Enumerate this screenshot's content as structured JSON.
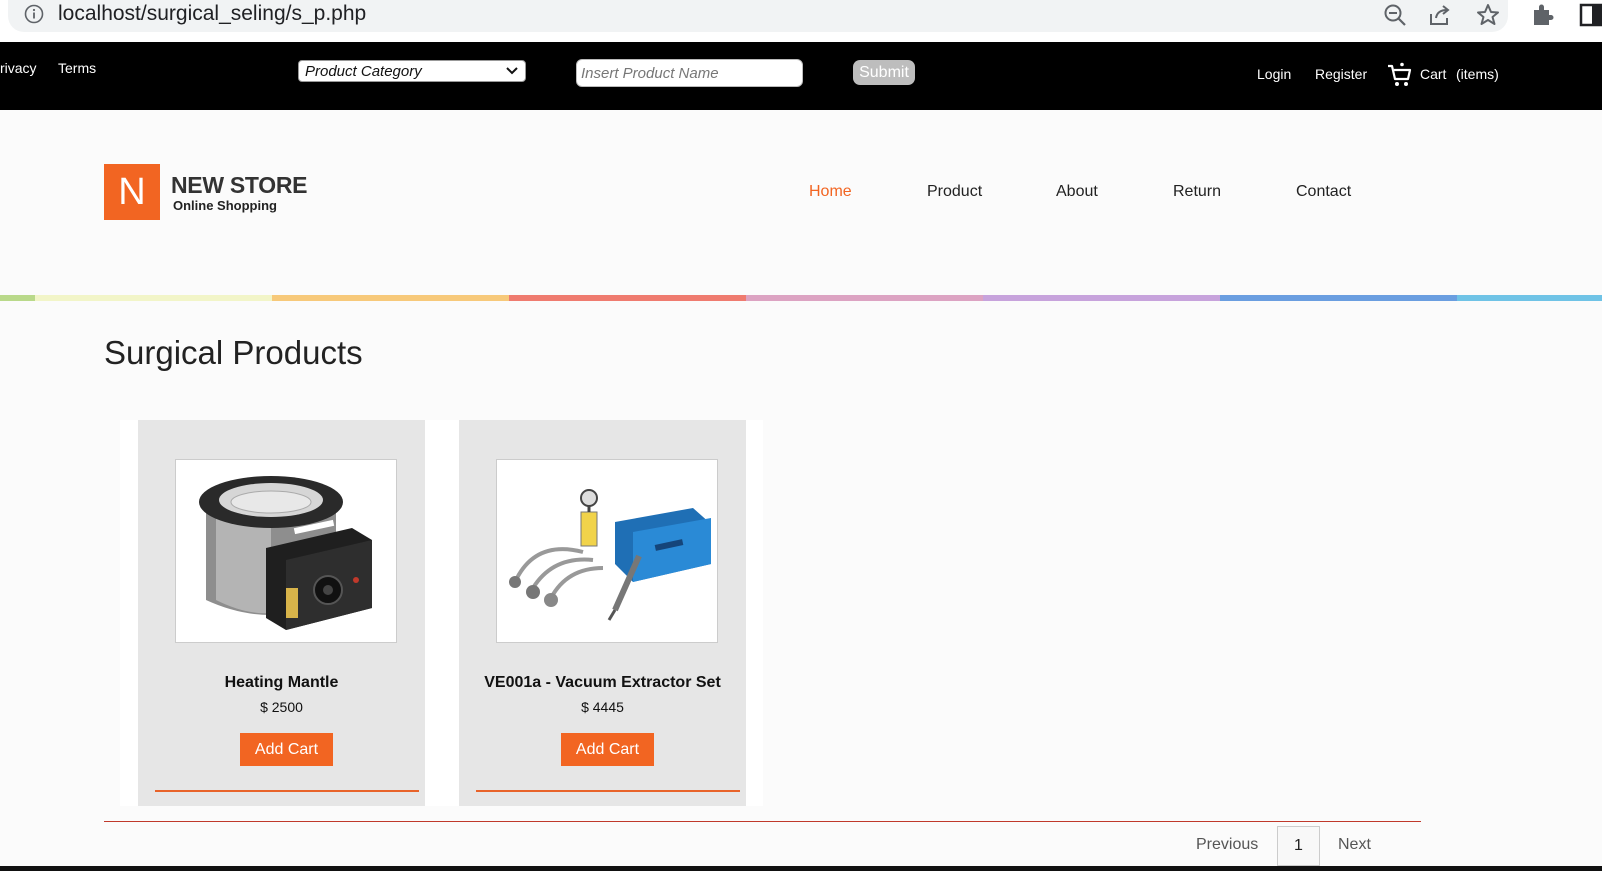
{
  "browser": {
    "url": "localhost/surgical_seling/s_p.php",
    "icons": [
      "info-icon",
      "zoom-out-icon",
      "share-icon",
      "star-icon",
      "extensions-icon",
      "sidepanel-icon"
    ]
  },
  "topbar": {
    "privacy": "rivacy",
    "terms": "Terms",
    "category_selected": "Product Category",
    "search_placeholder": "Insert Product Name",
    "submit": "Submit",
    "login": "Login",
    "register": "Register",
    "cart": "Cart",
    "cart_items": "(items)"
  },
  "header": {
    "logo_letter": "N",
    "store_name": "NEW STORE",
    "tagline": "Online Shopping",
    "nav": [
      "Home",
      "Product",
      "About",
      "Return",
      "Contact"
    ],
    "active_nav": "Home",
    "stripe_colors": [
      "#b9d98a",
      "#f2f5c8",
      "#f7c97a",
      "#ef7b6f",
      "#dca3c2",
      "#c7a3dc",
      "#6a9ee0",
      "#6fc3e6"
    ]
  },
  "main": {
    "title": "Surgical Products",
    "products": [
      {
        "name": "Heating Mantle",
        "price": "$ 2500",
        "button": "Add Cart"
      },
      {
        "name": "VE001a - Vacuum Extractor Set",
        "price": "$ 4445",
        "button": "Add Cart"
      }
    ],
    "pagination": {
      "previous": "Previous",
      "current": "1",
      "next": "Next"
    }
  },
  "colors": {
    "accent": "#f26522",
    "topbar": "#000000"
  }
}
